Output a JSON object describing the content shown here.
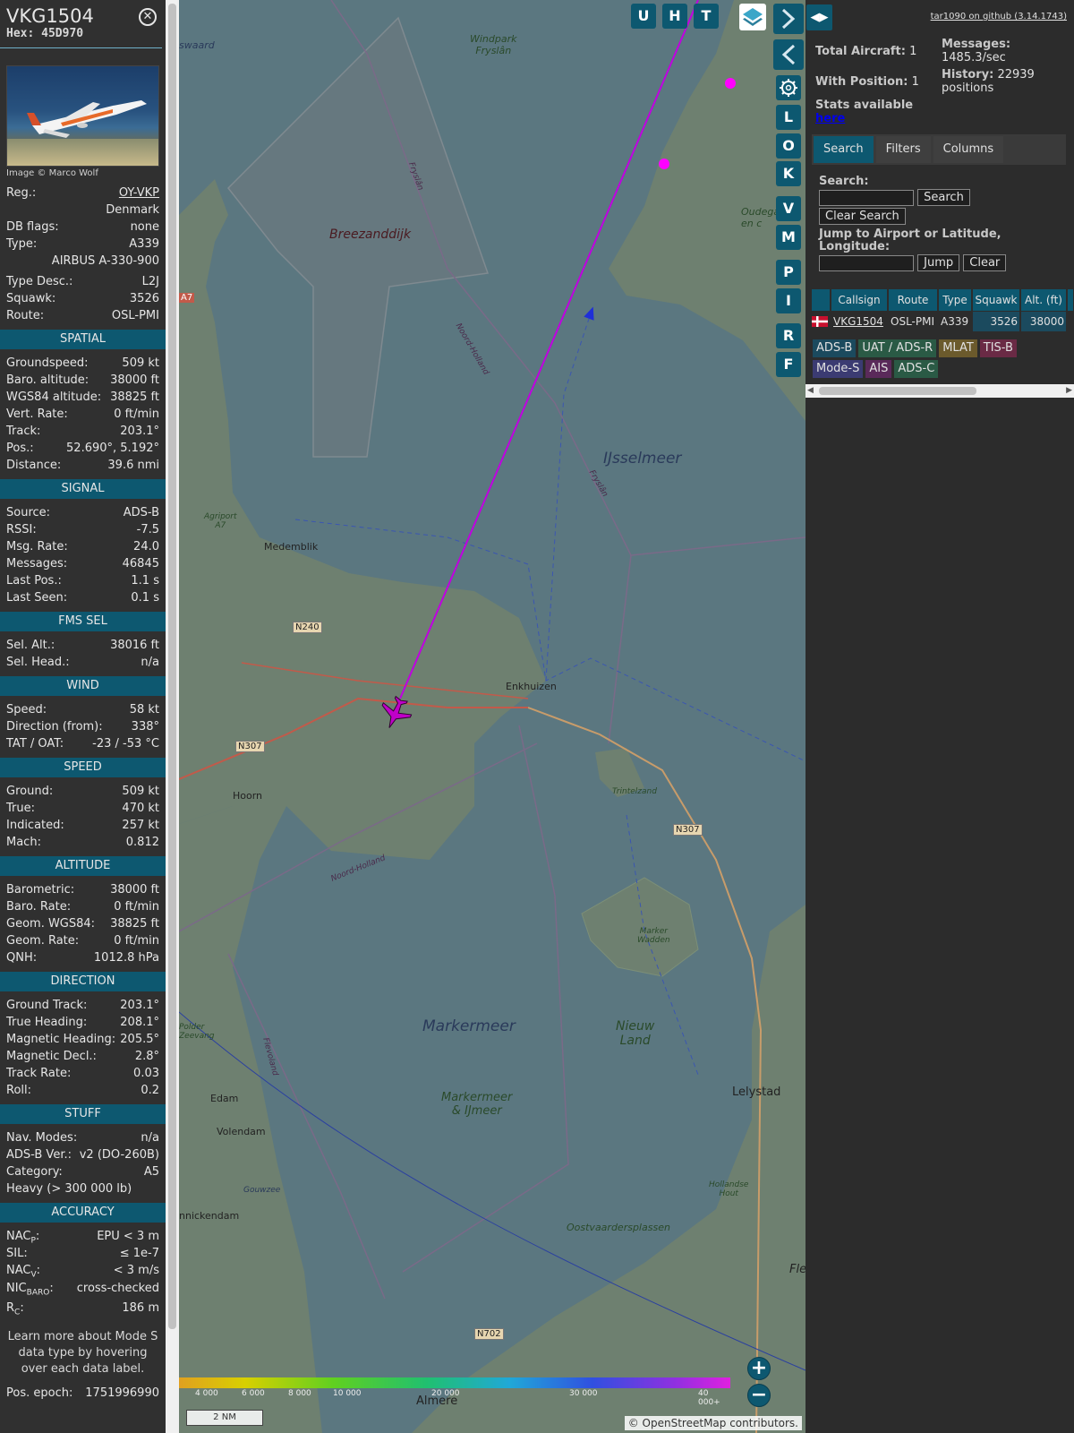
{
  "info": {
    "callsign": "VKG1504",
    "hex_label": "Hex:",
    "hex": "45D970",
    "photo_credit": "Image © Marco Wolf",
    "reg_label": "Reg.:",
    "reg": "OY-VKP",
    "country": "Denmark",
    "dbflags_label": "DB flags:",
    "dbflags": "none",
    "type_label": "Type:",
    "type": "A339",
    "type_full": "AIRBUS A-330-900",
    "typedesc_label": "Type Desc.:",
    "typedesc": "L2J",
    "squawk_label": "Squawk:",
    "squawk": "3526",
    "route_label": "Route:",
    "route": "OSL-PMI",
    "spatial": {
      "title": "SPATIAL",
      "rows": [
        [
          "Groundspeed:",
          "509 kt"
        ],
        [
          "Baro. altitude:",
          "38000 ft"
        ],
        [
          "WGS84 altitude:",
          "38825 ft"
        ],
        [
          "Vert. Rate:",
          "0 ft/min"
        ],
        [
          "Track:",
          "203.1°"
        ],
        [
          "Pos.:",
          "52.690°, 5.192°"
        ],
        [
          "Distance:",
          "39.6 nmi"
        ]
      ]
    },
    "signal": {
      "title": "SIGNAL",
      "rows": [
        [
          "Source:",
          "ADS-B"
        ],
        [
          "RSSI:",
          "-7.5"
        ],
        [
          "Msg. Rate:",
          "24.0"
        ],
        [
          "Messages:",
          "46845"
        ],
        [
          "Last Pos.:",
          "1.1 s"
        ],
        [
          "Last Seen:",
          "0.1 s"
        ]
      ]
    },
    "fms": {
      "title": "FMS SEL",
      "rows": [
        [
          "Sel. Alt.:",
          "38016 ft"
        ],
        [
          "Sel. Head.:",
          "n/a"
        ]
      ]
    },
    "wind": {
      "title": "WIND",
      "rows": [
        [
          "Speed:",
          "58 kt"
        ],
        [
          "Direction (from):",
          "338°"
        ],
        [
          "TAT / OAT:",
          "-23 / -53 °C"
        ]
      ]
    },
    "speed": {
      "title": "SPEED",
      "rows": [
        [
          "Ground:",
          "509 kt"
        ],
        [
          "True:",
          "470 kt"
        ],
        [
          "Indicated:",
          "257 kt"
        ],
        [
          "Mach:",
          "0.812"
        ]
      ]
    },
    "altitude": {
      "title": "ALTITUDE",
      "rows": [
        [
          "Barometric:",
          "38000 ft"
        ],
        [
          "Baro. Rate:",
          "0 ft/min"
        ],
        [
          "Geom. WGS84:",
          "38825 ft"
        ],
        [
          "Geom. Rate:",
          "0 ft/min"
        ],
        [
          "QNH:",
          "1012.8 hPa"
        ]
      ]
    },
    "direction": {
      "title": "DIRECTION",
      "rows": [
        [
          "Ground Track:",
          "203.1°"
        ],
        [
          "True Heading:",
          "208.1°"
        ],
        [
          "Magnetic Heading:",
          "205.5°"
        ],
        [
          "Magnetic Decl.:",
          "2.8°"
        ],
        [
          "Track Rate:",
          "0.03"
        ],
        [
          "Roll:",
          "0.2"
        ]
      ]
    },
    "stuff": {
      "title": "STUFF",
      "navmodes_label": "Nav. Modes:",
      "navmodes": "n/a",
      "adsbver_label": "ADS-B Ver.:",
      "adsbver": "v2 (DO-260B)",
      "category_label": "Category:",
      "category": "A5",
      "category_desc": "Heavy (> 300 000 lb)"
    },
    "accuracy": {
      "title": "ACCURACY",
      "nacp_label": "NAC",
      "nacp_sub": "P",
      "nacp": "EPU < 3 m",
      "sil_label": "SIL:",
      "sil": "≤ 1e-7",
      "nacv_label": "NAC",
      "nacv_sub": "V",
      "nacv": "< 3 m/s",
      "nicbaro_label": "NIC",
      "nicbaro_sub": "BARO",
      "nicbaro": "cross-checked",
      "rc_label": "R",
      "rc_sub": "C",
      "rc": "186 m"
    },
    "note": "Learn more about Mode S data type by hovering over each data label.",
    "epoch_label": "Pos. epoch:",
    "epoch": "1751996990"
  },
  "map": {
    "buttons_top": [
      "U",
      "H",
      "T"
    ],
    "buttons_side": [
      "L",
      "O",
      "K",
      "V",
      "M",
      "P",
      "I",
      "R",
      "F"
    ],
    "labels": {
      "windpark": "Windpark",
      "windpark2": "Fryslân",
      "breezanddijk": "Breezanddijk",
      "ijsselmeer": "IJsselmeer",
      "medemblik": "Medemblik",
      "enkhuizen": "Enkhuizen",
      "hoorn": "Hoorn",
      "markermeer": "Markermeer",
      "markermeer2": "Markermeer",
      "markermeer3": "& IJmeer",
      "nieuwland": "Nieuw",
      "nieuwland2": "Land",
      "lelystad": "Lelystad",
      "edam": "Edam",
      "volendam": "Volendam",
      "monnickendam": "nnickendam",
      "almere": "Almere",
      "oostvaarders": "Oostvaardersplassen",
      "trintelzand": "Trintelzand",
      "markerwadden": "Marker",
      "markerwadden2": "Wadden",
      "n240": "N240",
      "n307": "N307",
      "n307b": "N307",
      "n702": "N702",
      "a7": "A7",
      "agriport": "Agriport",
      "agriport2": "A7",
      "noordholland": "Noord-Holland",
      "noordholland2": "Noord-Holland",
      "fryslan": "Fryslân",
      "fryslan2": "Fryslân",
      "flevoland": "Flevoland",
      "oudega": "Oudega",
      "oudega2": "en c",
      "polder": "Polder",
      "polder2": "Zeevang",
      "gouwzee": "Gouwzee",
      "hollandse": "Hollandse",
      "hollandse2": "Hout",
      "fle": "Fle",
      "swaard": "swaard"
    },
    "altitude_scale": [
      "4 000",
      "6 000",
      "8 000",
      "10 000",
      "20 000",
      "30 000",
      "40 000+"
    ],
    "scale_bar": "2 NM",
    "attribution": "© OpenStreetMap contributors.",
    "zoom_in": "+",
    "zoom_out": "−"
  },
  "panel": {
    "toggle_icon": "◀▶",
    "github": "tar1090 on github (3.14.1743)",
    "total_label": "Total Aircraft:",
    "total": "1",
    "withpos_label": "With Position:",
    "withpos": "1",
    "stats_label": "Stats available",
    "stats_link": "here",
    "messages_label": "Messages:",
    "messages": "1485.3/sec",
    "history_label": "History:",
    "history": "22939",
    "history_unit": "positions",
    "tabs": [
      "Search",
      "Filters",
      "Columns"
    ],
    "search_label": "Search:",
    "search_btn": "Search",
    "clear_search_btn": "Clear Search",
    "jump_label": "Jump to Airport or Latitude, Longitude:",
    "jump_btn": "Jump",
    "clear_btn": "Clear",
    "table_headers": [
      "Callsign",
      "Route",
      "Type",
      "Squawk",
      "Alt. (ft)"
    ],
    "table_row": [
      "VKG1504",
      "OSL-PMI",
      "A339",
      "3526",
      "38000"
    ],
    "legend": [
      {
        "label": "ADS-B",
        "color": "#1b4a5e"
      },
      {
        "label": "UAT / ADS-R",
        "color": "#2a5a45"
      },
      {
        "label": "MLAT",
        "color": "#6b5a2c"
      },
      {
        "label": "TIS-B",
        "color": "#6a2a45"
      },
      {
        "label": "Mode-S",
        "color": "#3b3b72"
      },
      {
        "label": "AIS",
        "color": "#5a2a5a"
      },
      {
        "label": "ADS-C",
        "color": "#2a5a45"
      }
    ]
  }
}
